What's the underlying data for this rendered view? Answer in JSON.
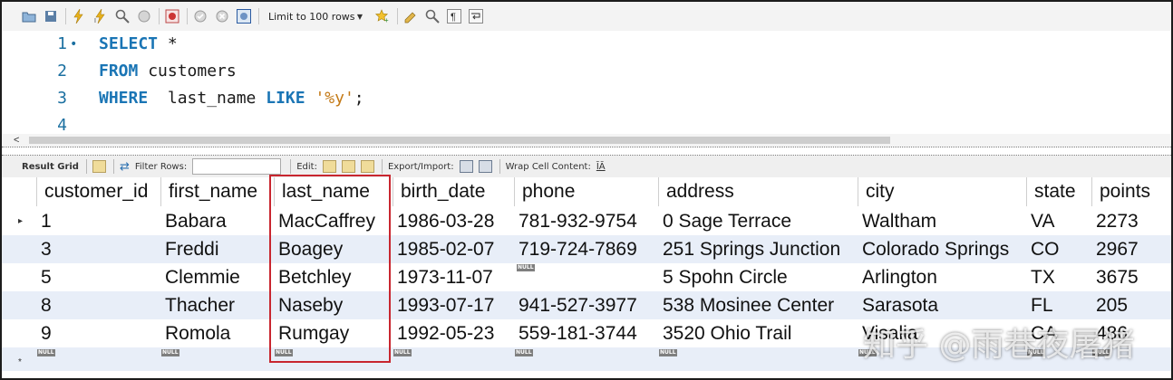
{
  "toolbar": {
    "limit_label": "Limit to 100 rows"
  },
  "editor": {
    "lines": [
      {
        "num": "1",
        "tokens": [
          {
            "t": "SELECT",
            "k": "kw"
          },
          {
            "t": " *",
            "k": "id"
          }
        ]
      },
      {
        "num": "2",
        "tokens": [
          {
            "t": "FROM",
            "k": "kw"
          },
          {
            "t": " customers",
            "k": "id"
          }
        ]
      },
      {
        "num": "3",
        "tokens": [
          {
            "t": "WHERE",
            "k": "kw"
          },
          {
            "t": "  last_name ",
            "k": "id"
          },
          {
            "t": "LIKE",
            "k": "kw"
          },
          {
            "t": " ",
            "k": "id"
          },
          {
            "t": "'%y'",
            "k": "str"
          },
          {
            "t": ";",
            "k": "id"
          }
        ]
      },
      {
        "num": "4",
        "tokens": []
      }
    ]
  },
  "result_toolbar": {
    "result_grid": "Result Grid",
    "filter_rows": "Filter Rows:",
    "edit": "Edit:",
    "export_import": "Export/Import:",
    "wrap_cell": "Wrap Cell Content:"
  },
  "grid": {
    "columns": [
      "customer_id",
      "first_name",
      "last_name",
      "birth_date",
      "phone",
      "address",
      "city",
      "state",
      "points"
    ],
    "rows": [
      [
        "1",
        "Babara",
        "MacCaffrey",
        "1986-03-28",
        "781-932-9754",
        "0 Sage Terrace",
        "Waltham",
        "VA",
        "2273"
      ],
      [
        "3",
        "Freddi",
        "Boagey",
        "1985-02-07",
        "719-724-7869",
        "251 Springs Junction",
        "Colorado Springs",
        "CO",
        "2967"
      ],
      [
        "5",
        "Clemmie",
        "Betchley",
        "1973-11-07",
        null,
        "5 Spohn Circle",
        "Arlington",
        "TX",
        "3675"
      ],
      [
        "8",
        "Thacher",
        "Naseby",
        "1993-07-17",
        "941-527-3977",
        "538 Mosinee Center",
        "Sarasota",
        "FL",
        "205"
      ],
      [
        "9",
        "Romola",
        "Rumgay",
        "1992-05-23",
        "559-181-3744",
        "3520 Ohio Trail",
        "Visalia",
        "CA",
        "486"
      ]
    ],
    "null_label": "NULL",
    "current_row_marker": "▸",
    "new_row_marker": "*"
  },
  "watermark": "知乎 @雨巷夜屠猪",
  "colors": {
    "keyword": "#1a75b5",
    "string": "#c47a17",
    "highlight_box": "#c8262f",
    "alt_row": "#e8eef8"
  }
}
